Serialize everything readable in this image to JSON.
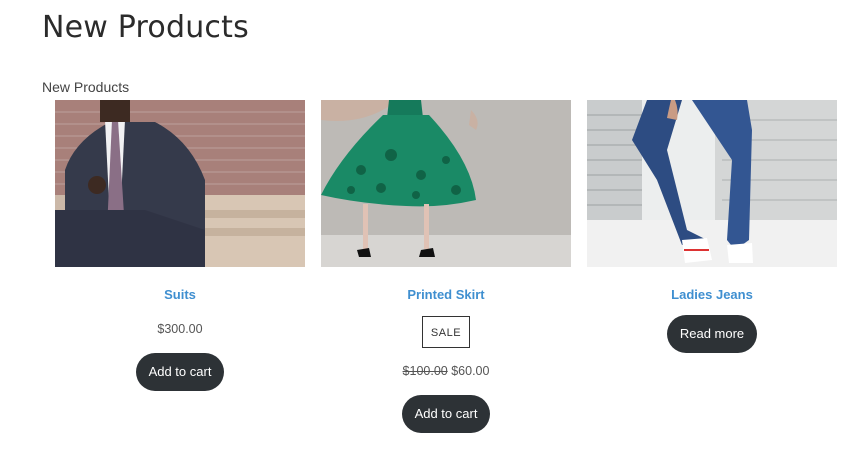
{
  "page": {
    "title": "New Products"
  },
  "section": {
    "title": "New Products"
  },
  "products": [
    {
      "name": "Suits",
      "price": "$300.00",
      "button": "Add to cart"
    },
    {
      "name": "Printed Skirt",
      "badge": "SALE",
      "old_price": "$100.00",
      "price": "$60.00",
      "button": "Add to cart"
    },
    {
      "name": "Ladies Jeans",
      "button": "Read more"
    }
  ],
  "colors": {
    "link": "#3f8fd0",
    "button_bg": "#2d3236",
    "button_text": "#ffffff"
  }
}
